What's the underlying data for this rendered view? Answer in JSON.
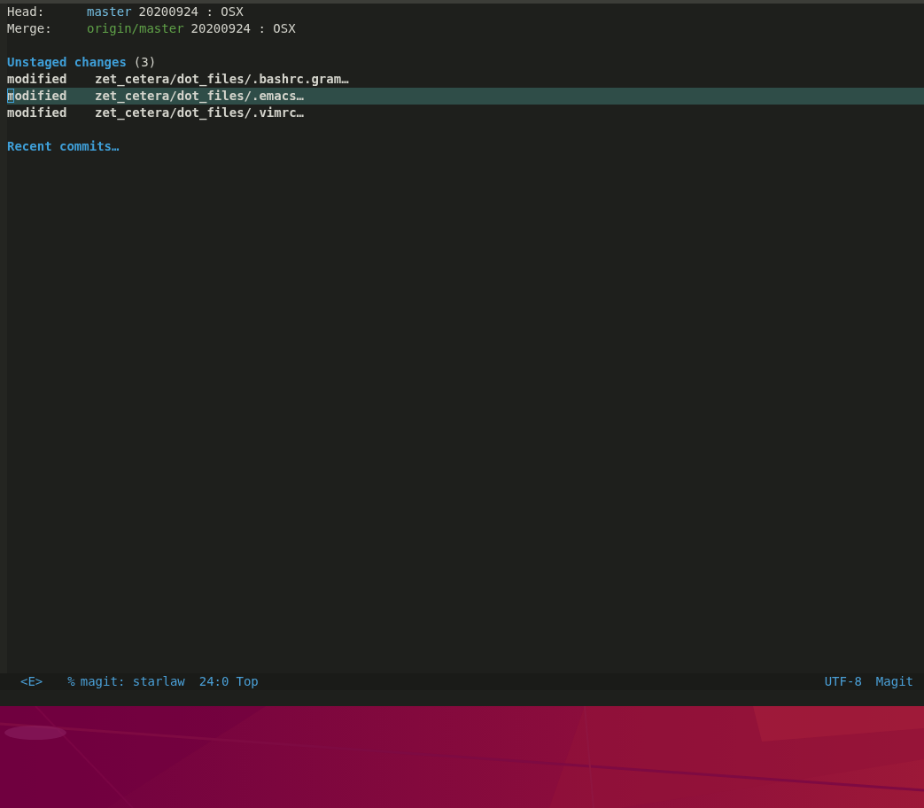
{
  "header": [
    {
      "label": "Head:",
      "ref": "master",
      "color": "#74bde0",
      "rest": "20200924 : OSX"
    },
    {
      "label": "Merge:",
      "ref": "origin/master",
      "color": "#5fa048",
      "rest": "20200924 : OSX"
    }
  ],
  "unstaged": {
    "title": "Unstaged changes",
    "count": "(3)",
    "files": [
      {
        "status": "modified",
        "path": "zet_cetera/dot_files/.bashrc.gram…",
        "selected": false
      },
      {
        "status": "modified",
        "path": "zet_cetera/dot_files/.emacs…",
        "selected": true
      },
      {
        "status": "modified",
        "path": "zet_cetera/dot_files/.vimrc…",
        "selected": false
      }
    ]
  },
  "recent": {
    "title": "Recent commits…"
  },
  "mode_line": {
    "state": "<E>",
    "flag": "%",
    "buffer": "magit: starlaw",
    "position": "24:0",
    "scroll": "Top",
    "encoding": "UTF-8",
    "mode": "Magit"
  }
}
